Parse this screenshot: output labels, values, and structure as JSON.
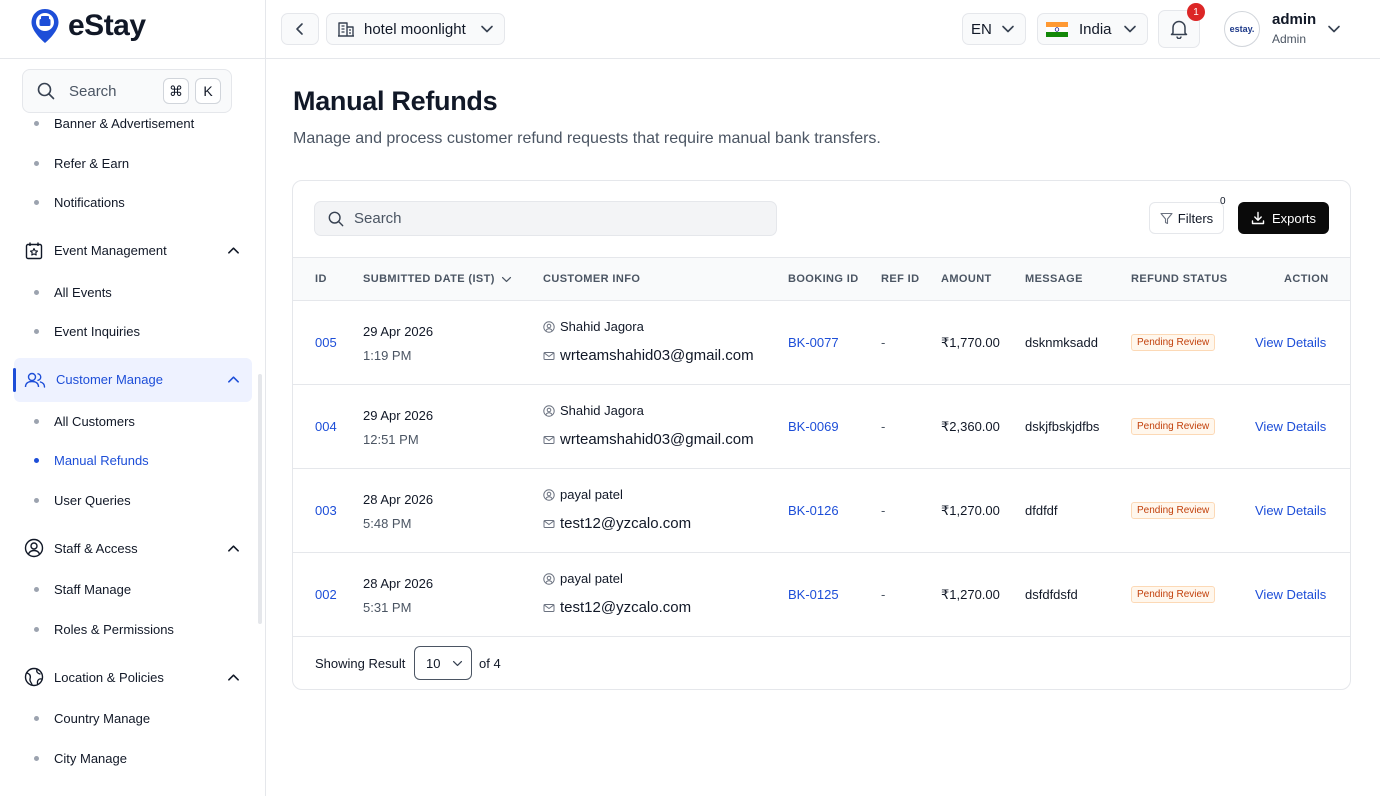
{
  "brand": {
    "name": "eStay",
    "avatar_text": "estay."
  },
  "sidebar": {
    "search_placeholder": "Search",
    "shortcut": [
      "⌘",
      "K"
    ],
    "items": [
      {
        "kind": "sub",
        "label": "Banner & Advertisement",
        "name": "sidebar-item-banner-advertisement"
      },
      {
        "kind": "sub",
        "label": "Refer & Earn",
        "name": "sidebar-item-refer-earn"
      },
      {
        "kind": "sub",
        "label": "Notifications",
        "name": "sidebar-item-notifications"
      },
      {
        "kind": "section",
        "label": "Event Management",
        "icon": "calendar-star-icon",
        "name": "sidebar-section-event-management"
      },
      {
        "kind": "sub",
        "label": "All Events",
        "name": "sidebar-item-all-events"
      },
      {
        "kind": "sub",
        "label": "Event Inquiries",
        "name": "sidebar-item-event-inquiries"
      },
      {
        "kind": "section",
        "label": "Customer Manage",
        "icon": "users-icon",
        "active": true,
        "name": "sidebar-section-customer-manage"
      },
      {
        "kind": "sub",
        "label": "All Customers",
        "name": "sidebar-item-all-customers"
      },
      {
        "kind": "sub",
        "label": "Manual Refunds",
        "active": true,
        "name": "sidebar-item-manual-refunds"
      },
      {
        "kind": "sub",
        "label": "User Queries",
        "name": "sidebar-item-user-queries"
      },
      {
        "kind": "section",
        "label": "Staff & Access",
        "icon": "user-circle-icon",
        "name": "sidebar-section-staff-access"
      },
      {
        "kind": "sub",
        "label": "Staff Manage",
        "name": "sidebar-item-staff-manage"
      },
      {
        "kind": "sub",
        "label": "Roles & Permissions",
        "name": "sidebar-item-roles-permissions"
      },
      {
        "kind": "section",
        "label": "Location & Policies",
        "icon": "globe-icon",
        "name": "sidebar-section-location-policies"
      },
      {
        "kind": "sub",
        "label": "Country Manage",
        "name": "sidebar-item-country-manage"
      },
      {
        "kind": "sub",
        "label": "City Manage",
        "name": "sidebar-item-city-manage"
      }
    ]
  },
  "topbar": {
    "hotel": "hotel moonlight",
    "language": "EN",
    "country": "India",
    "notification_count": "1",
    "user_name": "admin",
    "user_role": "Admin"
  },
  "page": {
    "title": "Manual Refunds",
    "subtitle": "Manage and process customer refund requests that require manual bank transfers."
  },
  "table": {
    "search_placeholder": "Search",
    "filters_label": "Filters",
    "filters_count": "0",
    "exports_label": "Exports",
    "columns": {
      "id": "ID",
      "submitted": "SUBMITTED DATE (IST)",
      "customer": "CUSTOMER INFO",
      "booking": "BOOKING ID",
      "ref": "REF ID",
      "amount": "AMOUNT",
      "message": "MESSAGE",
      "status": "REFUND STATUS",
      "action": "ACTION"
    },
    "rows": [
      {
        "id": "005",
        "date": "29 Apr 2026",
        "time": "1:19 PM",
        "name": "Shahid Jagora",
        "email": "wrteamshahid03@gmail.com",
        "booking": "BK-0077",
        "ref": "-",
        "amount": "₹1,770.00",
        "message": "dsknmksadd",
        "status": "Pending Review",
        "action": "View Details"
      },
      {
        "id": "004",
        "date": "29 Apr 2026",
        "time": "12:51 PM",
        "name": "Shahid Jagora",
        "email": "wrteamshahid03@gmail.com",
        "booking": "BK-0069",
        "ref": "-",
        "amount": "₹2,360.00",
        "message": "dskjfbskjdfbs",
        "status": "Pending Review",
        "action": "View Details"
      },
      {
        "id": "003",
        "date": "28 Apr 2026",
        "time": "5:48 PM",
        "name": "payal patel",
        "email": "test12@yzcalo.com",
        "booking": "BK-0126",
        "ref": "-",
        "amount": "₹1,270.00",
        "message": "dfdfdf",
        "status": "Pending Review",
        "action": "View Details"
      },
      {
        "id": "002",
        "date": "28 Apr 2026",
        "time": "5:31 PM",
        "name": "payal patel",
        "email": "test12@yzcalo.com",
        "booking": "BK-0125",
        "ref": "-",
        "amount": "₹1,270.00",
        "message": "dsfdfdsfd",
        "status": "Pending Review",
        "action": "View Details"
      }
    ],
    "footer": {
      "label": "Showing Result",
      "page_size": "10",
      "of_total": "of 4"
    }
  },
  "colors": {
    "accent": "#1d4ed8",
    "status_pending": "#c2410c",
    "notification": "#dc2626"
  }
}
